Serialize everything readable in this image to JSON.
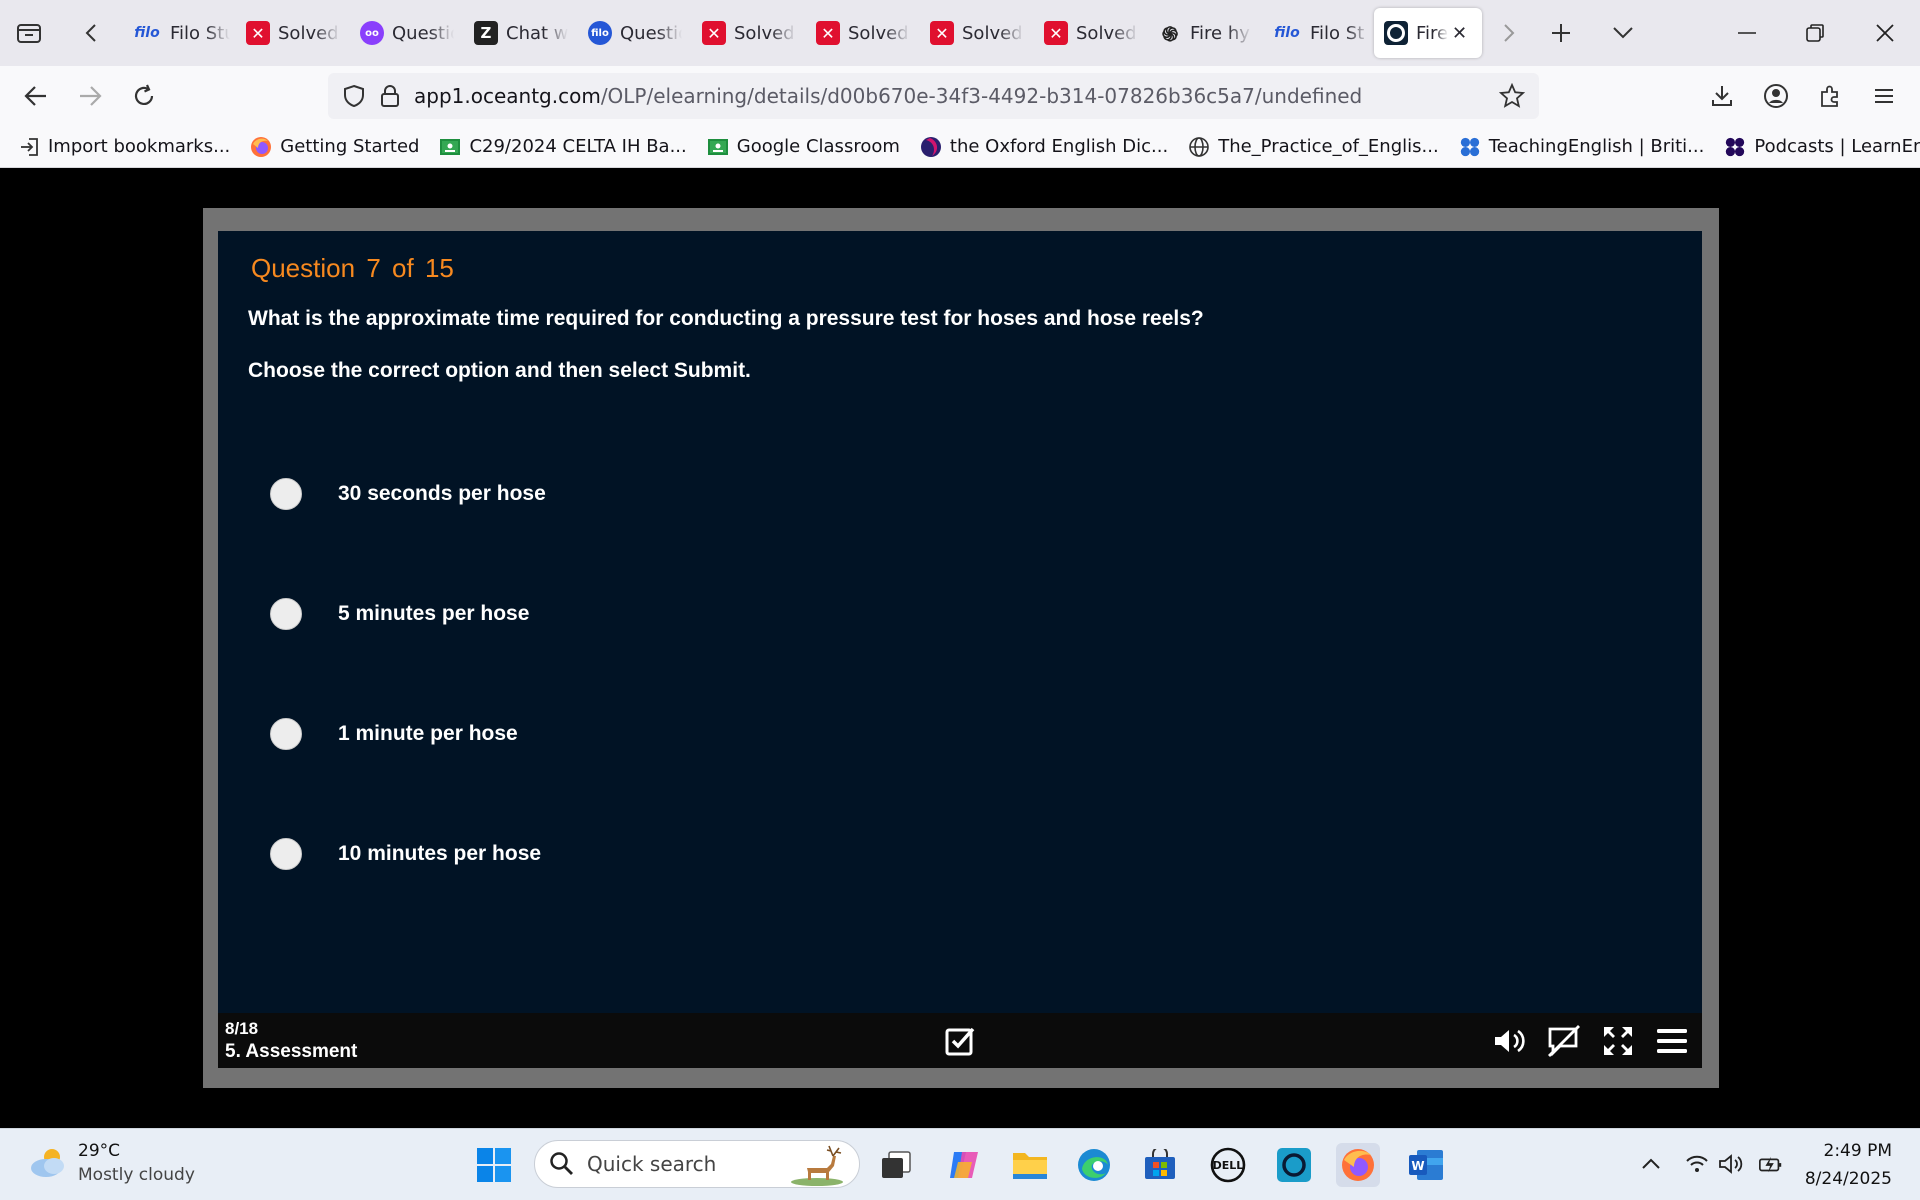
{
  "tabs": [
    {
      "label": "Filo Student",
      "favicon": "filo"
    },
    {
      "label": "Solved",
      "favicon": "x"
    },
    {
      "label": "Question",
      "favicon": "owl"
    },
    {
      "label": "Chat with",
      "favicon": "z"
    },
    {
      "label": "Question",
      "favicon": "filo-circle"
    },
    {
      "label": "Solved",
      "favicon": "x"
    },
    {
      "label": "Solved",
      "favicon": "x"
    },
    {
      "label": "Solved",
      "favicon": "x"
    },
    {
      "label": "Solved",
      "favicon": "x"
    },
    {
      "label": "Fire hy",
      "favicon": "chatgpt"
    },
    {
      "label": "Filo St",
      "favicon": "filo"
    },
    {
      "label": "Fire",
      "favicon": "oceantg",
      "active": true
    }
  ],
  "address_bar": {
    "url_host": "app1.oceantg.com",
    "url_path": "/OLP/elearning/details/d00b670e-34f3-4492-b314-07826b36c5a7/undefined"
  },
  "bookmarks": [
    {
      "label": "Import bookmarks...",
      "icon": "import-icon"
    },
    {
      "label": "Getting Started",
      "icon": "firefox-icon"
    },
    {
      "label": "C29/2024 CELTA IH Ba...",
      "icon": "classroom-icon"
    },
    {
      "label": "Google Classroom",
      "icon": "classroom-icon"
    },
    {
      "label": "the Oxford English Dic...",
      "icon": "oed-icon"
    },
    {
      "label": "The_Practice_of_Englis...",
      "icon": "globe-icon"
    },
    {
      "label": "TeachingEnglish | Briti...",
      "icon": "british-council-icon"
    },
    {
      "label": "Podcasts | LearnEnglish",
      "icon": "british-council-icon"
    }
  ],
  "quiz": {
    "question_label": "Question",
    "question_number": "7",
    "question_of": "of",
    "question_total": "15",
    "question_text": "What is the approximate time required for conducting a pressure test for hoses and hose reels?",
    "instruction": "Choose the correct option and then select Submit.",
    "options": [
      "30 seconds per hose",
      "5 minutes per hose",
      "1 minute per hose",
      "10 minutes per hose"
    ]
  },
  "player_bar": {
    "slide_counter": "8/18",
    "section_title": "5. Assessment"
  },
  "taskbar": {
    "temperature": "29°C",
    "weather": "Mostly cloudy",
    "search_placeholder": "Quick search",
    "time": "2:49 PM",
    "date": "8/24/2025"
  },
  "colors": {
    "slide_bg": "#011325",
    "question_accent": "#f7891f",
    "frame": "#737373"
  }
}
